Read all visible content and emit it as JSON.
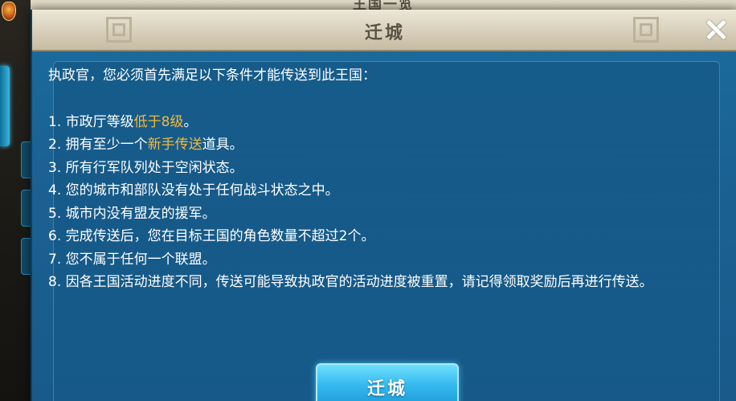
{
  "background": {
    "behind_window_title": "王国一览"
  },
  "dialog": {
    "title": "迁城",
    "close_icon": "close-icon",
    "intro": "执政官，您必须首先满足以下条件才能传送到此王国：",
    "conditions": [
      {
        "before": "1. 市政厅等级",
        "highlight": "低于8级",
        "after": "。"
      },
      {
        "before": "2. 拥有至少一个",
        "highlight": "新手传送",
        "after": "道具。"
      },
      {
        "before": "3. 所有行军队列处于空闲状态。",
        "highlight": "",
        "after": ""
      },
      {
        "before": "4. 您的城市和部队没有处于任何战斗状态之中。",
        "highlight": "",
        "after": ""
      },
      {
        "before": "5. 城市内没有盟友的援军。",
        "highlight": "",
        "after": ""
      },
      {
        "before": "6. 完成传送后，您在目标王国的角色数量不超过2个。",
        "highlight": "",
        "after": ""
      },
      {
        "before": "7. 您不属于任何一个联盟。",
        "highlight": "",
        "after": ""
      },
      {
        "before": "8. 因各王国活动进度不同，传送可能导致执政官的活动进度被重置，请记得领取奖励后再进行传送。",
        "highlight": "",
        "after": ""
      }
    ],
    "button_label": "迁城"
  },
  "colors": {
    "highlight": "#f5b93a",
    "panel_blue": "#1a6293",
    "button_blue": "#35b9ee",
    "header_parchment": "#d8cfbb"
  }
}
